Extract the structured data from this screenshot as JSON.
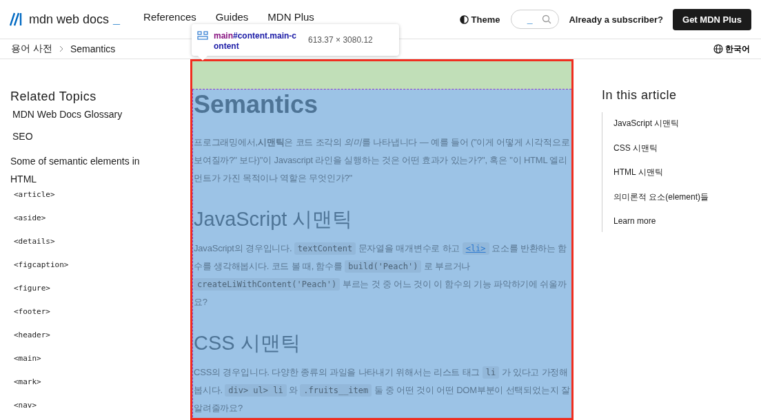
{
  "header": {
    "logo": "mdn web docs",
    "logo_cursor": "_",
    "nav": [
      "References",
      "Guides",
      "MDN Plus"
    ],
    "theme": "Theme",
    "search_cursor": "_",
    "subscriber": "Already a subscriber?",
    "cta": "Get MDN Plus"
  },
  "inspector_tooltip": {
    "tag": "main",
    "selector": "#content.main-content",
    "size": "613.37 × 3080.12"
  },
  "breadcrumbs": [
    "용어 사전",
    "Semantics"
  ],
  "language": "한국어",
  "sidebar": {
    "title": "Related Topics",
    "links": [
      "MDN Web Docs Glossary",
      "SEO"
    ],
    "section": "Some of semantic elements in HTML",
    "elements": [
      "<article>",
      "<aside>",
      "<details>",
      "<figcaption>",
      "<figure>",
      "<footer>",
      "<header>",
      "<main>",
      "<mark>",
      "<nav>"
    ]
  },
  "article": {
    "title": "Semantics",
    "blocks": [
      {
        "kind": "paragraph",
        "parts": [
          {
            "kind": "text",
            "text": "프로그래밍에서,"
          },
          {
            "kind": "bold",
            "text": "시맨틱"
          },
          {
            "kind": "text",
            "text": "은 코드 조각의 "
          },
          {
            "kind": "italic",
            "text": "의미"
          },
          {
            "kind": "text",
            "text": "를 나타냅니다 — 예를 들어 (\"이게 어떻게 시각적으로 보여질까?\" 보다)\"이 Javascript 라인을 실행하는 것은 어떤 효과가 있는가?\", 혹은 \"이 HTML 엘리먼트가 가진 목적이나 역할은 무엇인가?\""
          }
        ]
      },
      {
        "kind": "heading",
        "text": "JavaScript 시맨틱"
      },
      {
        "kind": "paragraph",
        "parts": [
          {
            "kind": "text",
            "text": "JavaScript의 경우입니다. "
          },
          {
            "kind": "code",
            "text": "textContent"
          },
          {
            "kind": "text",
            "text": " 문자열을 매개변수로 하고 "
          },
          {
            "kind": "link",
            "text": "<li>"
          },
          {
            "kind": "text",
            "text": " 요소를 반환하는 함수를 생각해봅시다. 코드 볼 때, 함수를 "
          },
          {
            "kind": "code",
            "text": "build('Peach')"
          },
          {
            "kind": "text",
            "text": " 로 부르거나 "
          },
          {
            "kind": "code",
            "text": "createLiWithContent('Peach')"
          },
          {
            "kind": "text",
            "text": " 부르는 것 중 어느 것이 이 함수의 기능 파악하기에 쉬울까요?"
          }
        ]
      },
      {
        "kind": "heading",
        "text": "CSS 시맨틱"
      },
      {
        "kind": "paragraph",
        "parts": [
          {
            "kind": "text",
            "text": "CSS의 경우입니다. 다양한 종류의 과일을 나타내기 위해서는 리스트 태그 "
          },
          {
            "kind": "code",
            "text": "li"
          },
          {
            "kind": "text",
            "text": " 가 있다고 가정해봅시다. "
          },
          {
            "kind": "code",
            "text": "div> ul> li"
          },
          {
            "kind": "text",
            "text": " 와 "
          },
          {
            "kind": "code",
            "text": ".fruits__item"
          },
          {
            "kind": "text",
            "text": " 둘 중 어떤 것이 어떤 DOM부분이 선택되었는지 잘 알려줄까요?"
          }
        ]
      }
    ]
  },
  "toc": {
    "title": "In this article",
    "items": [
      "JavaScript 시맨틱",
      "CSS 시맨틱",
      "HTML 시맨틱",
      "의미론적 요소(element)들",
      "Learn more"
    ]
  }
}
